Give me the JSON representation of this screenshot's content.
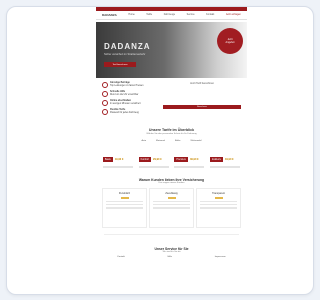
{
  "nav": {
    "brand": "DADANZA",
    "links": [
      "Home",
      "Tarife",
      "Fahrzeuge",
      "Service",
      "Kontakt"
    ],
    "cta": "Jetzt anfragen"
  },
  "hero": {
    "title": "DADANZA",
    "subtitle": "Sicher versichert im Straßenverkehr",
    "button": "Tarif berechnen",
    "badge_line1": "Jetzt",
    "badge_line2": "Angebot"
  },
  "benefits": {
    "items": [
      {
        "title": "Günstige Beiträge",
        "text": "Top Leistungen zu fairen Preisen"
      },
      {
        "title": "Schnelle Hilfe",
        "text": "Rund um die Uhr erreichbar"
      },
      {
        "title": "Online abschließen",
        "text": "In wenigen Minuten versichert"
      },
      {
        "title": "Flexible Tarife",
        "text": "Passend für jedes Fahrzeug"
      }
    ],
    "form_title": "Jetzt Tarif berechnen",
    "form_button": "Berechnen"
  },
  "pricing": {
    "title": "Unsere Tarife im Überblick",
    "subtitle": "Wählen Sie den passenden Schutz für Ihr Fahrzeug",
    "tabs": [
      "Auto",
      "Motorrad",
      "Roller",
      "Wohnmobil"
    ],
    "plans": [
      {
        "name": "Basis",
        "price": "19,90 €"
      },
      {
        "name": "Komfort",
        "price": "29,90 €"
      },
      {
        "name": "Premium",
        "price": "39,90 €"
      },
      {
        "name": "Exklusiv",
        "price": "49,90 €"
      }
    ]
  },
  "features": {
    "title": "Warum Kunden lieben ihre Versicherung",
    "subtitle": "Das sagen unsere Kunden",
    "cards": [
      {
        "title": "Persönlich"
      },
      {
        "title": "Zuverlässig"
      },
      {
        "title": "Transparent"
      }
    ]
  },
  "footer": {
    "title": "Unser Service für Sie",
    "subtitle": "Wir sind für Sie da",
    "columns": [
      "Kontakt",
      "Hilfe",
      "Impressum"
    ]
  }
}
